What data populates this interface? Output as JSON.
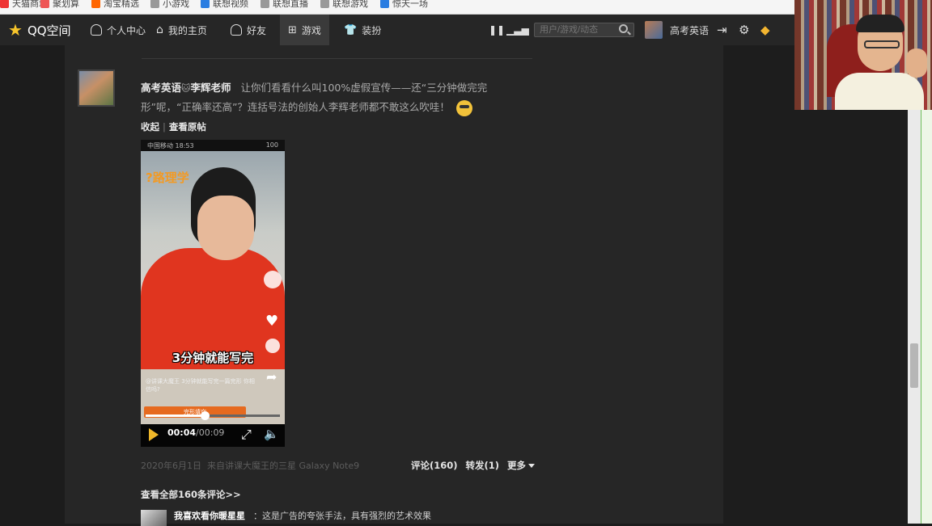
{
  "bookmarks": [
    {
      "label": "天猫商城",
      "color": "#e33"
    },
    {
      "label": "聚划算",
      "color": "#e55"
    },
    {
      "label": "淘宝精选",
      "color": "#f60"
    },
    {
      "label": "小游戏",
      "color": "#999"
    },
    {
      "label": "联想视频",
      "color": "#2a7de1"
    },
    {
      "label": "联想直播",
      "color": "#999"
    },
    {
      "label": "联想游戏",
      "color": "#999"
    },
    {
      "label": "惊天一场",
      "color": "#2a7de1"
    }
  ],
  "nav": {
    "logo": "QQ空间",
    "personal_center": "个人中心",
    "my_home": "我的主页",
    "friends": "好友",
    "games": "游戏",
    "dress": "装扮",
    "search_placeholder": "用户/游戏/动态",
    "username": "高考英语"
  },
  "post": {
    "author": "高考英语",
    "author_suffix": "李辉老师",
    "text": "让你们看看什么叫100%虚假宣传——还“三分钟做完完形”呢，“正确率还高”？连括号法的创始人李辉老师都不敢这么吹哇！",
    "collect": "收起",
    "view_original": "查看原帖",
    "date": "2020年6月1日",
    "source": "来自讲课大魔王的三星 Galaxy Note9",
    "comments": "评论(160)",
    "forwards": "转发(1)",
    "more": "更多",
    "view_all_comments": "查看全部160条评论>>"
  },
  "video": {
    "status_time": "中国移动 18:53",
    "battery": "100",
    "caption": "3分钟就能写完",
    "logo_text": "?路理学",
    "desc": "@讲课大魔王 3分钟就能写完一篇完形 你相信吗?",
    "orange_label": "完形填空",
    "current_time": "00:04",
    "duration": "00:09",
    "progress": 0.44
  },
  "comment": {
    "name": "我喜欢看你暖星星",
    "text": "：这是广告的夸张手法，具有强烈的艺术效果"
  }
}
